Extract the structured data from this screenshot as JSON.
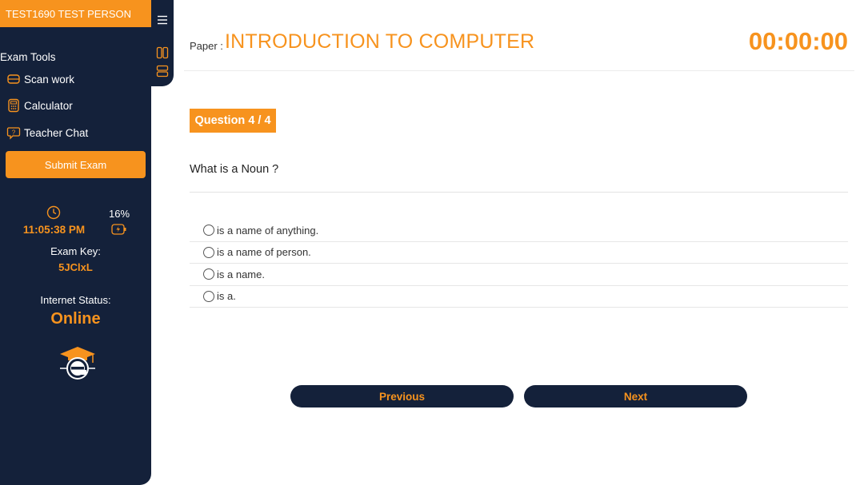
{
  "user": {
    "name": "TEST1690 TEST PERSON"
  },
  "sidebar": {
    "tools_title": "Exam Tools",
    "tools": [
      {
        "label": "Scan work",
        "icon": "scan-icon"
      },
      {
        "label": "Calculator",
        "icon": "calculator-icon"
      },
      {
        "label": "Teacher Chat",
        "icon": "chat-icon"
      }
    ],
    "submit_label": "Submit Exam",
    "time": "11:05:38 PM",
    "battery": "16%",
    "exam_key_label": "Exam Key:",
    "exam_key": "5JClxL",
    "internet_label": "Internet Status:",
    "internet_status": "Online"
  },
  "header": {
    "paper_label": "Paper :",
    "paper_title": "INTRODUCTION TO COMPUTER",
    "timer": "00:00:00"
  },
  "question": {
    "badge": "Question 4 / 4",
    "text": "What is a Noun ?",
    "options": [
      "is a name of anything.",
      "is a name of person.",
      "is a name.",
      "is a."
    ]
  },
  "nav": {
    "previous_label": "Previous",
    "next_label": "Next"
  },
  "colors": {
    "accent": "#f7931e",
    "navy": "#14213a"
  }
}
